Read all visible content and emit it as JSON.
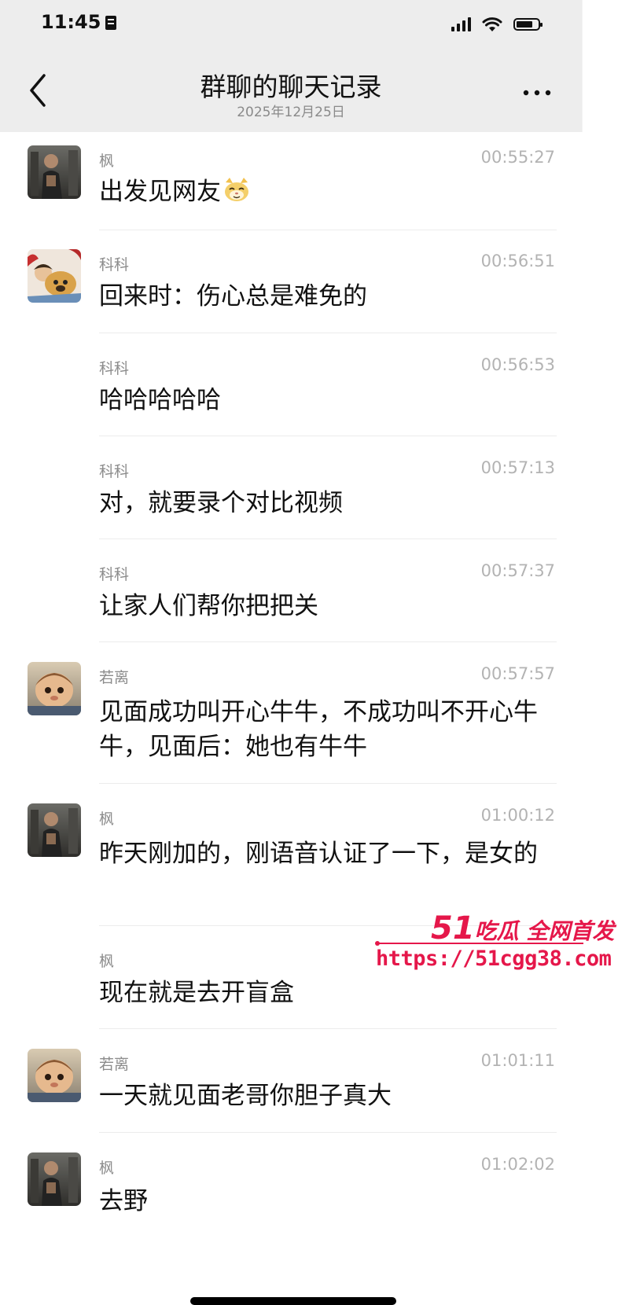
{
  "status_bar": {
    "time": "11:45"
  },
  "header": {
    "title": "群聊的聊天记录",
    "subtitle": "2025年12月25日"
  },
  "messages": [
    {
      "sender": "枫",
      "time": "00:55:27",
      "text": "出发见网友",
      "emoji": "cat-face-icon",
      "avatar": "feng"
    },
    {
      "sender": "科科",
      "time": "00:56:51",
      "text": "回来时：伤心总是难免的",
      "avatar": "keke"
    },
    {
      "sender": "科科",
      "time": "00:56:53",
      "text": "哈哈哈哈哈"
    },
    {
      "sender": "科科",
      "time": "00:57:13",
      "text": "对，就要录个对比视频"
    },
    {
      "sender": "科科",
      "time": "00:57:37",
      "text": "让家人们帮你把把关"
    },
    {
      "sender": "若离",
      "time": "00:57:57",
      "text": "见面成功叫开心牛牛，不成功叫不开心牛牛，见面后：她也有牛牛",
      "avatar": "ruoli"
    },
    {
      "sender": "枫",
      "time": "01:00:12",
      "text": "昨天刚加的，刚语音认证了一下，是女的",
      "avatar": "feng"
    },
    {
      "sender": "枫",
      "time": "",
      "text": "现在就是去开盲盒"
    },
    {
      "sender": "若离",
      "time": "01:01:11",
      "text": "一天就见面老哥你胆子真大",
      "avatar": "ruoli"
    },
    {
      "sender": "枫",
      "time": "01:02:02",
      "text": "去野",
      "avatar": "feng"
    }
  ],
  "watermark": {
    "number": "51",
    "slogan": "吃瓜 全网首发",
    "url": "https://51cgg38.com"
  },
  "colors": {
    "header_bg": "#ededed",
    "watermark": "#e5174a",
    "time_text": "#b3b3b3"
  }
}
